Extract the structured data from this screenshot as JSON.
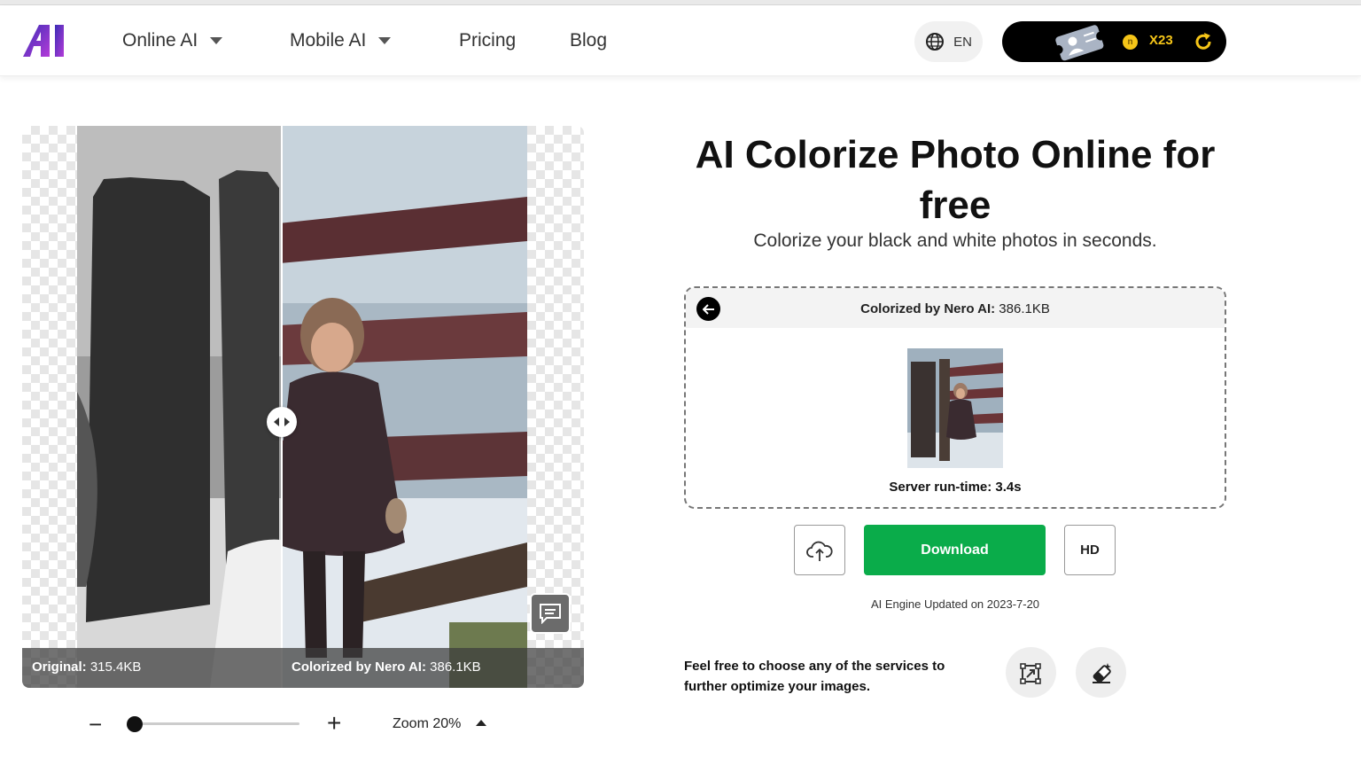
{
  "header": {
    "logo_text": "AI",
    "nav": [
      {
        "label": "Online AI",
        "has_dropdown": true
      },
      {
        "label": "Mobile AI",
        "has_dropdown": true
      },
      {
        "label": "Pricing",
        "has_dropdown": false
      },
      {
        "label": "Blog",
        "has_dropdown": false
      }
    ],
    "language": {
      "label": "EN",
      "icon": "globe-icon"
    },
    "credits": {
      "count": "X23",
      "icons": [
        "ticket-icon",
        "coin-icon",
        "refresh-icon"
      ]
    }
  },
  "viewer": {
    "original_label": "Original:",
    "original_size": "315.4KB",
    "colorized_label": "Colorized by Nero AI:",
    "colorized_size": "386.1KB",
    "icons": [
      "compare-handle-icon",
      "feedback-icon"
    ]
  },
  "zoom": {
    "minus": "−",
    "plus": "+",
    "label": "Zoom 20%",
    "value_percent": 20
  },
  "hero": {
    "title": "AI Colorize Photo Online for free",
    "subtitle": "Colorize your black and white photos in seconds."
  },
  "result": {
    "label": "Colorized by Nero AI:",
    "size": "386.1KB",
    "runtime": "Server run-time: 3.4s"
  },
  "actions": {
    "upload_icon": "cloud-upload-icon",
    "download_label": "Download",
    "hd_label": "HD",
    "engine_note": "AI Engine Updated on 2023-7-20"
  },
  "services": {
    "text": "Feel free to choose any of the services to further optimize your images.",
    "icons": [
      "crop-upscale-icon",
      "eraser-icon"
    ]
  },
  "colors": {
    "accent_green": "#0aac4a",
    "credit_gold": "#f5c518",
    "logo_gradient": [
      "#3b2db5",
      "#b43bd8"
    ]
  }
}
